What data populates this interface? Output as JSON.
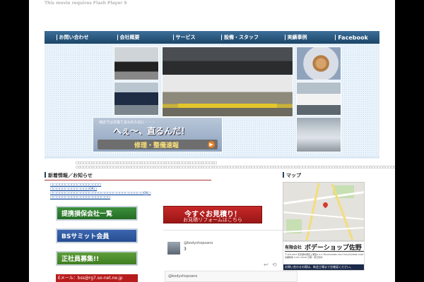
{
  "flash_notice": "This movie requires Flash Player 9",
  "nav": {
    "items": [
      "お問い合わせ",
      "会社概要",
      "サービス",
      "設備・スタッフ",
      "実績事例",
      "Facebook"
    ]
  },
  "hero": {
    "promo_sub": "他店では交換て言われたのに・・・",
    "promo_main": "へぇ〜、直るんだ！",
    "promo_bar": "修理・整備速報",
    "promo_arrow": "▶"
  },
  "intro": {
    "line1": "□□□□□□□□□□□□□□□□□□□□□□□□□□□□□□□□□□□□□□□□□□□□□□□□□□□□□",
    "line2": "□□□□□□□□□□□□□□□□□□□□□□□□□□□□□□□□□□□□□□□□□□□□□□□□□□□□□□□□□□□□□□□□□□□□□□□□□□□□□□□□□□□□□□□□□□□□□□□□□□□□□□□□□□□□□□□□□□□□□□□□□□□□□16□□□□□□□□□□□□□□□□□□□□□□□□□□□□□□□□□□□□□□□□□□□□□□□"
  },
  "news": {
    "heading": "新着情報／お知らせ",
    "items": [
      "□□□□□□□□□□□□□□□□□",
      "□□□□□□□□□□□□□OK□",
      "□□□□□□□□□□□□□□□□□□□□□□□□□□□□□□□OK□",
      "□□□□□□□□□□□□□□□□□□□□"
    ]
  },
  "map_heading": "マップ",
  "buttons": {
    "partner": "提携損保会社一覧",
    "bs": "BSサミット会員",
    "recruit": "正社員募集!!",
    "email": "Eメール：bss@rg7.so-net.ne.jp"
  },
  "estimate": {
    "main": "今すぐお見積り！",
    "sub": "お見積リフォームはこちら"
  },
  "tweets": {
    "handle": "@bodyshopsano",
    "body": "3",
    "reply_icon": "↩",
    "retweet_icon": "⟲",
    "handle2": "@bodyshopsano"
  },
  "company": {
    "type": "有限会社",
    "name": "ボデーショップ佐野",
    "address": "〒165-0031 東京都中野区上鷺宮2-3-4 TEL(03)3999-7427 FAX(03)3999-7428 営業時間 9:00〜18:00 日曜・祝日定休",
    "bar": "お問い合わせの際は、新会工場まで言確認ください。"
  },
  "colors": {
    "nav_blue": "#1b4568",
    "accent_red": "#b71c1c",
    "link_blue": "#1a4fa0"
  }
}
